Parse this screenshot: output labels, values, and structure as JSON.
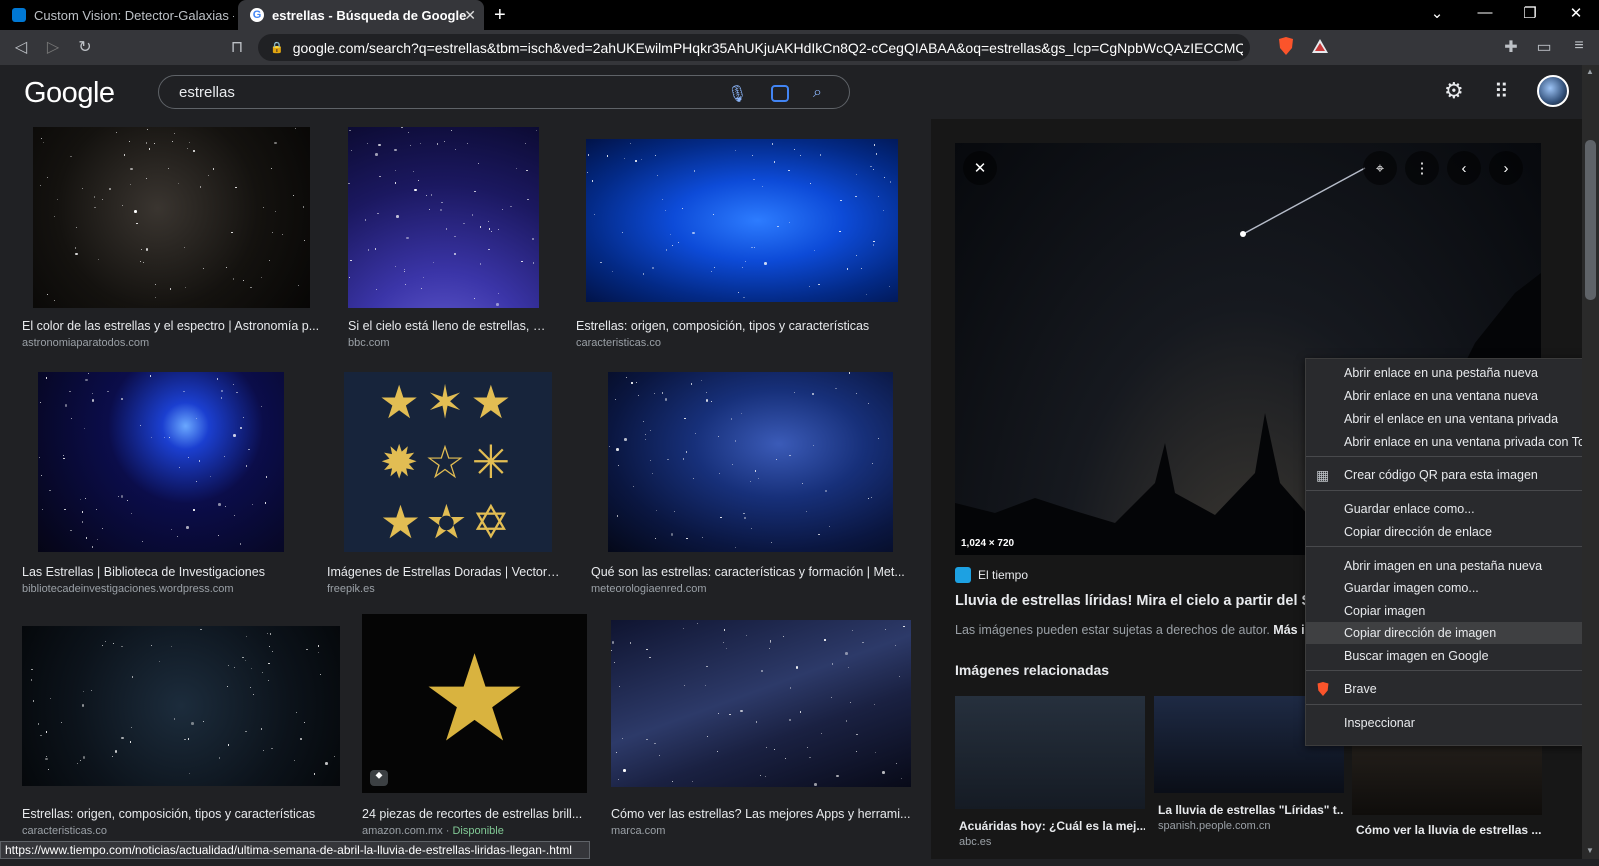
{
  "browser": {
    "tabs": [
      {
        "title": "Custom Vision: Detector-Galaxias - Pe",
        "active": false
      },
      {
        "title": "estrellas - Búsqueda de Google",
        "active": true
      }
    ],
    "url": "google.com/search?q=estrellas&tbm=isch&ved=2ahUKEwilmPHqkr35AhUKjuAKHdIkCn8Q2-cCegQIABAA&oq=estrellas&gs_lcp=CgNpbWcQAzIECCMQJzI...",
    "status_url": "https://www.tiempo.com/noticias/actualidad/ultima-semana-de-abril-la-lluvia-de-estrellas-liridas-llegan-.html"
  },
  "google": {
    "logo": "Google",
    "query": "estrellas"
  },
  "results": [
    {
      "caption": "El color de las estrellas y el espectro | Astronomía p...",
      "source": "astronomiaparatodos.com"
    },
    {
      "caption": "Si el cielo está lleno de estrellas, ¿...",
      "source": "bbc.com"
    },
    {
      "caption": "Estrellas: origen, composición, tipos y características",
      "source": "caracteristicas.co"
    },
    {
      "caption": "Las Estrellas | Biblioteca de Investigaciones",
      "source": "bibliotecadeinvestigaciones.wordpress.com"
    },
    {
      "caption": "Imágenes de Estrellas Doradas | Vectore...",
      "source": "freepik.es"
    },
    {
      "caption": "Qué son las estrellas: características y formación | Met...",
      "source": "meteorologiaenred.com"
    },
    {
      "caption": "Estrellas: origen, composición, tipos y características",
      "source": "caracteristicas.co"
    },
    {
      "caption": "24 piezas de recortes de estrellas brill...",
      "source": "amazon.com.mx",
      "availability": "Disponible"
    },
    {
      "caption": "Cómo ver las estrellas? Las mejores Apps y herrami...",
      "source": "marca.com"
    }
  ],
  "preview": {
    "dimensions": "1,024 × 720",
    "source_name": "El tiempo",
    "title": "Lluvia de estrellas líridas! Mira el cielo a partir del Sá",
    "copyright_note": "Las imágenes pueden estar sujetas a derechos de autor.",
    "more_link": "Más i",
    "related_heading": "Imágenes relacionadas",
    "related": [
      {
        "caption": "Acuáridas hoy: ¿Cuál es la mej...",
        "source": "abc.es"
      },
      {
        "caption": "La lluvia de estrellas \"Líridas\" t...",
        "source": "spanish.people.com.cn"
      },
      {
        "caption": "Cómo ver la lluvia de estrellas ...",
        "source": ""
      }
    ]
  },
  "context_menu": {
    "items": [
      "Abrir enlace en una pestaña nueva",
      "Abrir enlace en una ventana nueva",
      "Abrir el enlace en una ventana privada",
      "Abrir enlace en una ventana privada con Tor",
      "Crear código QR para esta imagen",
      "Guardar enlace como...",
      "Copiar dirección de enlace",
      "Abrir imagen en una pestaña nueva",
      "Guardar imagen como...",
      "Copiar imagen",
      "Copiar dirección de imagen",
      "Buscar imagen en Google",
      "Brave",
      "Inspeccionar"
    ],
    "highlighted": "Copiar dirección de imagen"
  },
  "colors": {
    "background": "#202124",
    "tabstrip": "#000000",
    "toolbar": "#35363a",
    "menu": "#292a2d",
    "brave_orange": "#fb542b"
  }
}
